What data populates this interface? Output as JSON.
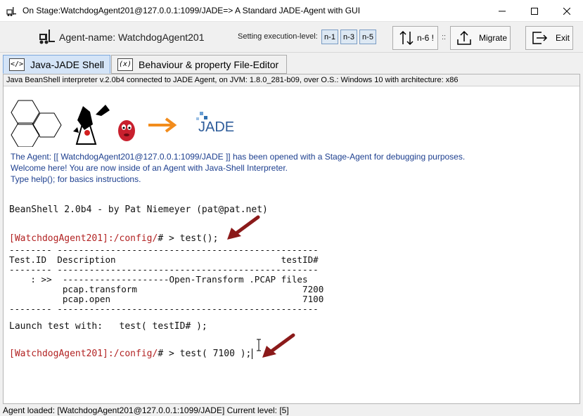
{
  "window": {
    "title": "On Stage:WatchdogAgent201@127.0.0.1:1099/JADE=> A Standard JADE-Agent with GUI"
  },
  "toolbar": {
    "agent_name": "Agent-name: WatchdogAgent201",
    "level_label": "Setting execution-level:",
    "level_buttons": [
      "n-1",
      "n-3",
      "n-5"
    ],
    "n6_label": "n-6 !",
    "colons": "::",
    "migrate_label": "Migrate",
    "exit_label": "Exit"
  },
  "tabs": [
    {
      "icon": "</>",
      "label": "Java-JADE Shell"
    },
    {
      "icon": "(x)",
      "label": "Behaviour & property File-Editor"
    }
  ],
  "shell": {
    "header": "Java BeanShell interpreter v.2.0b4 connected to JADE Agent, on JVM: 1.8.0_281-b09, over O.S.: Windows 10 with architecture: x86",
    "logo_text": "JADE",
    "welcome": [
      "The Agent: [[ WatchdogAgent201@127.0.0.1:1099/JADE ]] has been opened with a Stage-Agent for debugging purposes.",
      "Welcome here! You are now inside of an Agent with Java-Shell Interpreter.",
      "Type help(); for basics instructions."
    ],
    "beanshell_line": "BeanShell 2.0b4 - by Pat Niemeyer (pat@pat.net)",
    "prompt1": "[WatchdogAgent201]:/config/",
    "cmd1": "# > test();",
    "table_lines": [
      "-------- -------------------------------------------------",
      "Test.ID  Description                               testID#",
      "-------- -------------------------------------------------",
      "    : >>  --------------------Open-Transform .PCAP files",
      "          pcap.transform                               7200",
      "          pcap.open                                    7100",
      "-------- -------------------------------------------------"
    ],
    "launch_line": "Launch test with:   test( testID# );",
    "prompt2": "[WatchdogAgent201]:/config/",
    "cmd2": "# > test( 7100 );"
  },
  "status": {
    "text": "Agent loaded: [WatchdogAgent201@127.0.0.1:1099/JADE] Current level: [5]"
  },
  "colors": {
    "prompt": "#b22222",
    "welcome": "#1d3f8f",
    "arrow": "#8b1a1a",
    "jade_orange": "#f28c1c"
  }
}
